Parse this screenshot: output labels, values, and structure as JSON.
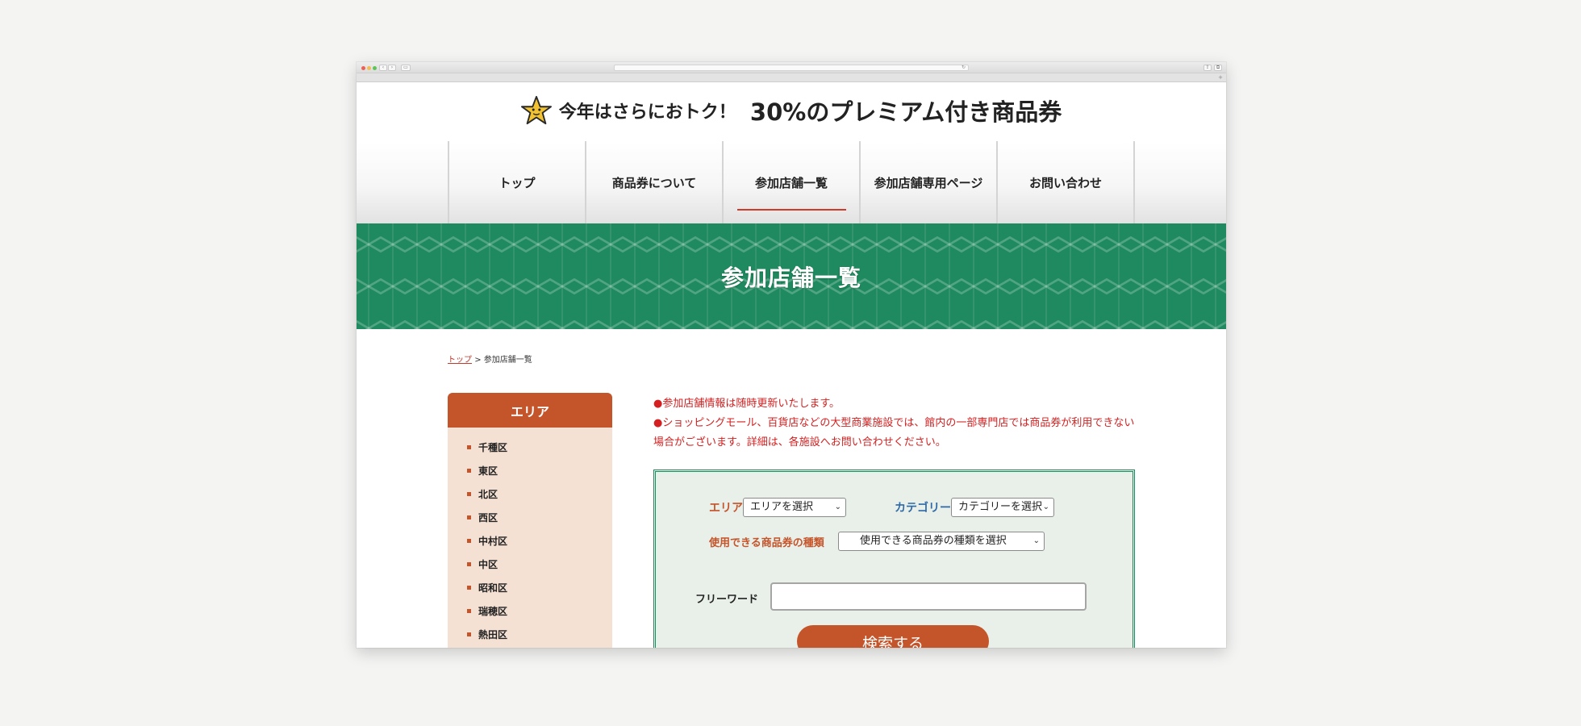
{
  "logo": {
    "lead": "今年はさらにおトク！",
    "main": "30%のプレミアム付き商品券"
  },
  "nav": {
    "items": [
      {
        "label": "トップ"
      },
      {
        "label": "商品券について"
      },
      {
        "label": "参加店舗一覧"
      },
      {
        "label": "参加店舗専用ページ"
      },
      {
        "label": "お問い合わせ"
      }
    ]
  },
  "banner": {
    "title": "参加店舗一覧"
  },
  "breadcrumb": {
    "home": "トップ",
    "separator": ">",
    "current": "参加店舗一覧"
  },
  "sidebar": {
    "title": "エリア",
    "areas": [
      "千種区",
      "東区",
      "北区",
      "西区",
      "中村区",
      "中区",
      "昭和区",
      "瑞穂区",
      "熱田区"
    ]
  },
  "notes": {
    "line1": "●参加店舗情報は随時更新いたします。",
    "line2": "●ショッピングモール、百貨店などの大型商業施設では、館内の一部専門店では商品券が利用できない場合がございます。詳細は、各施設へお問い合わせください。"
  },
  "search": {
    "area_label": "エリア",
    "area_select": "エリアを選択",
    "category_label": "カテゴリー",
    "category_select": "カテゴリーを選択",
    "voucher_label": "使用できる商品券の種類",
    "voucher_select": "使用できる商品券の種類を選択",
    "freeword_label": "フリーワード",
    "freeword_value": "",
    "button": "検索する"
  },
  "colors": {
    "accent_orange": "#c4542a",
    "brand_green": "#1f8a5f",
    "notice_red": "#d42020",
    "category_blue": "#2f6aa8"
  }
}
